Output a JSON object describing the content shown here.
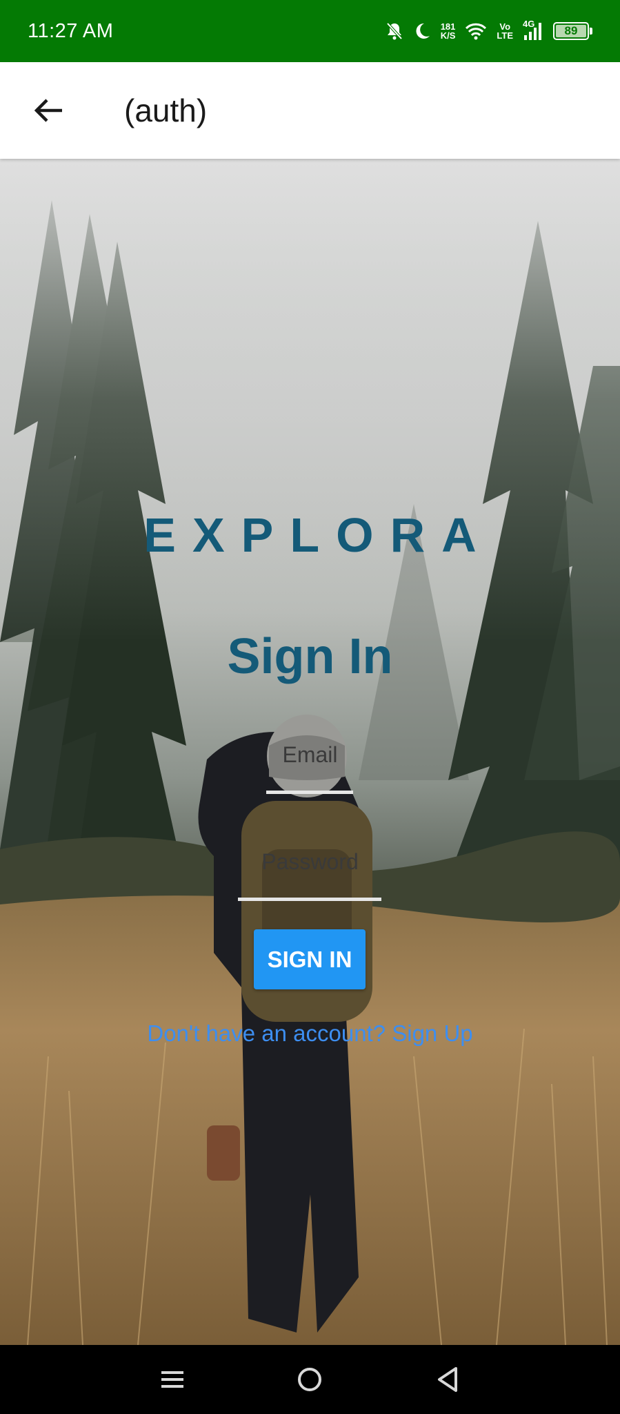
{
  "status_bar": {
    "time": "11:27 AM",
    "net_speed_value": "181",
    "net_speed_unit": "K/S",
    "volte_top": "Vo",
    "volte_bottom": "LTE",
    "network": "4G",
    "battery": "89",
    "color": "#047a04"
  },
  "app_bar": {
    "title": "(auth)",
    "back_icon": "arrow-left-icon"
  },
  "form": {
    "brand": "EXPLORA",
    "heading": "Sign In",
    "email_placeholder": "Email",
    "password_placeholder": "Password",
    "submit_label": "SIGN IN",
    "signup_link": "Don't have an account? Sign Up",
    "heading_color": "#145a78",
    "button_color": "#2196f3",
    "link_color": "#3d8ef0"
  },
  "nav_bar": {
    "icons": [
      "menu-icon",
      "home-circle-icon",
      "back-triangle-icon"
    ]
  }
}
